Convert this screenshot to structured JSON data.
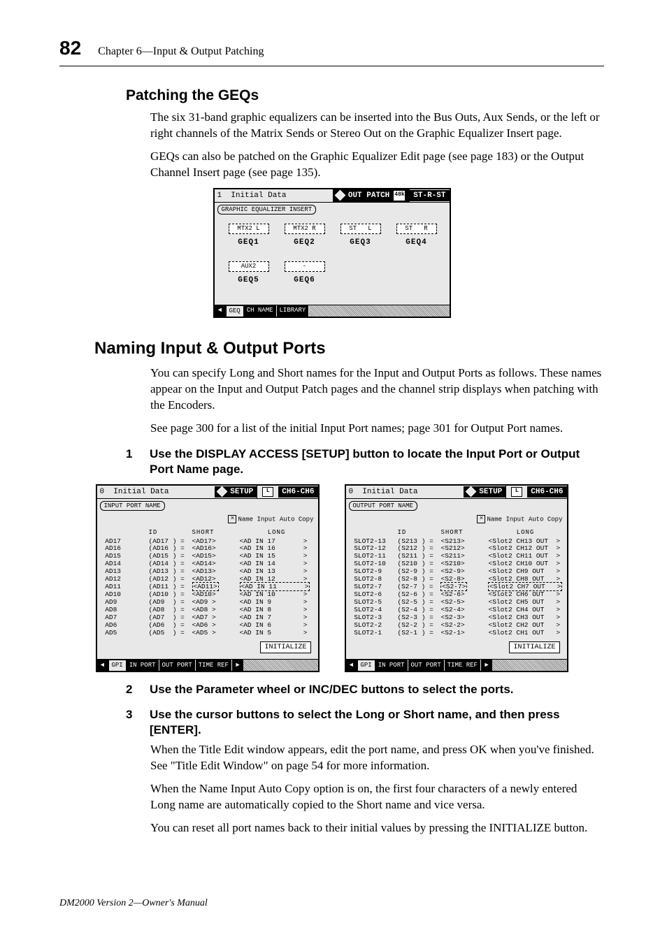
{
  "page": {
    "number": "82",
    "chapter_ref": "Chapter 6—Input & Output Patching",
    "footer": "DM2000 Version 2—Owner's Manual"
  },
  "sec_geq": {
    "title": "Patching the GEQs",
    "p1": "The six 31-band graphic equalizers can be inserted into the Bus Outs, Aux Sends, or the left or right channels of the Matrix Sends or Stereo Out on the Graphic Equalizer Insert page.",
    "p2": "GEQs can also be patched on the Graphic Equalizer Edit page (see page 183) or the Output Channel Insert page (see page 135)."
  },
  "geq_lcd": {
    "title_left": "1  Initial Data",
    "title_mid_a": "OUT PATCH",
    "title_mid_b_icon": "48k",
    "title_right": "ST-R-ST",
    "tab": "GRAPHIC EQUALIZER INSERT",
    "cells": [
      {
        "slot": "MTX2 L",
        "label": "GEQ1"
      },
      {
        "slot": "MTX2 R",
        "label": "GEQ2"
      },
      {
        "slot": "ST   L",
        "label": "GEQ3"
      },
      {
        "slot": "ST   R",
        "label": "GEQ4"
      },
      {
        "slot": "AUX2",
        "label": "GEQ5"
      },
      {
        "slot": "-",
        "label": "GEQ6"
      }
    ],
    "tabs": [
      "GEQ",
      "CH NAME",
      "LIBRARY"
    ]
  },
  "sec_naming": {
    "title": "Naming Input & Output Ports",
    "p1": "You can specify Long and Short names for the Input and Output Ports as follows. These names appear on the Input and Output Patch pages and the channel strip displays when patching with the Encoders.",
    "p2": "See page 300 for a list of the initial Input Port names; page 301 for Output Port names."
  },
  "steps": {
    "s1": "Use the DISPLAY ACCESS [SETUP] button to locate the Input Port or Output Port Name page.",
    "s2": "Use the Parameter wheel or INC/DEC buttons to select the ports.",
    "s3": "Use the cursor buttons to select the Long or Short name, and then press [ENTER]."
  },
  "after_steps": {
    "p1": "When the Title Edit window appears, edit the port name, and press OK when you've finished. See \"Title Edit Window\" on page 54 for more information.",
    "p2": "When the Name Input Auto Copy option is on, the first four characters of a newly entered Long name are automatically copied to the Short name and vice versa.",
    "p3": "You can reset all port names back to their initial values by pressing the INITIALIZE button."
  },
  "port_common": {
    "setup": "SETUP",
    "ch": "CH6-CH6",
    "check": "Name Input Auto Copy",
    "col_id": "ID",
    "col_short": "SHORT",
    "col_long": "LONG",
    "initialize": "INITIALIZE",
    "bottom_tabs": [
      "GPI",
      "IN PORT",
      "OUT PORT",
      "TIME REF"
    ]
  },
  "input_lcd": {
    "title_left": "0  Initial Data",
    "tab": "INPUT PORT NAME",
    "rows": [
      {
        "name": "AD17",
        "id": "(AD17 )",
        "short": "<AD17>",
        "long": "<AD IN 17       >"
      },
      {
        "name": "AD16",
        "id": "(AD16 )",
        "short": "<AD16>",
        "long": "<AD IN 16       >"
      },
      {
        "name": "AD15",
        "id": "(AD15 )",
        "short": "<AD15>",
        "long": "<AD IN 15       >"
      },
      {
        "name": "AD14",
        "id": "(AD14 )",
        "short": "<AD14>",
        "long": "<AD IN 14       >"
      },
      {
        "name": "AD13",
        "id": "(AD13 )",
        "short": "<AD13>",
        "long": "<AD IN 13       >"
      },
      {
        "name": "AD12",
        "id": "(AD12 )",
        "short": "<AD12>",
        "long": "<AD IN 12       >"
      },
      {
        "name": "AD11",
        "id": "(AD11 )",
        "short": "<AD11>",
        "long": "<AD IN 11       >",
        "hl": true
      },
      {
        "name": "AD10",
        "id": "(AD10 )",
        "short": "<AD10>",
        "long": "<AD IN 10       >"
      },
      {
        "name": "AD9",
        "id": "(AD9  )",
        "short": "<AD9 >",
        "long": "<AD IN 9        >"
      },
      {
        "name": "AD8",
        "id": "(AD8  )",
        "short": "<AD8 >",
        "long": "<AD IN 8        >"
      },
      {
        "name": "AD7",
        "id": "(AD7  )",
        "short": "<AD7 >",
        "long": "<AD IN 7        >"
      },
      {
        "name": "AD6",
        "id": "(AD6  )",
        "short": "<AD6 >",
        "long": "<AD IN 6        >"
      },
      {
        "name": "AD5",
        "id": "(AD5  )",
        "short": "<AD5 >",
        "long": "<AD IN 5        >"
      }
    ]
  },
  "output_lcd": {
    "title_left": "0  Initial Data",
    "tab": "OUTPUT PORT NAME",
    "rows": [
      {
        "name": "SLOT2-13",
        "id": "(S213 )",
        "short": "<S213>",
        "long": "<Slot2 CH13 OUT  >"
      },
      {
        "name": "SLOT2-12",
        "id": "(S212 )",
        "short": "<S212>",
        "long": "<Slot2 CH12 OUT  >"
      },
      {
        "name": "SLOT2-11",
        "id": "(S211 )",
        "short": "<S211>",
        "long": "<Slot2 CH11 OUT  >"
      },
      {
        "name": "SLOT2-10",
        "id": "(S210 )",
        "short": "<S210>",
        "long": "<Slot2 CH10 OUT  >"
      },
      {
        "name": "SLOT2-9",
        "id": "(S2-9 )",
        "short": "<S2-9>",
        "long": "<Slot2 CH9 OUT   >"
      },
      {
        "name": "SLOT2-8",
        "id": "(S2-8 )",
        "short": "<S2-8>",
        "long": "<Slot2 CH8 OUT   >"
      },
      {
        "name": "SLOT2-7",
        "id": "(S2-7 )",
        "short": "<S2-7>",
        "long": "<Slot2 CH7 OUT   >",
        "hl": true
      },
      {
        "name": "SLOT2-6",
        "id": "(S2-6 )",
        "short": "<S2-6>",
        "long": "<Slot2 CH6 OUT   >"
      },
      {
        "name": "SLOT2-5",
        "id": "(S2-5 )",
        "short": "<S2-5>",
        "long": "<Slot2 CH5 OUT   >"
      },
      {
        "name": "SLOT2-4",
        "id": "(S2-4 )",
        "short": "<S2-4>",
        "long": "<Slot2 CH4 OUT   >"
      },
      {
        "name": "SLOT2-3",
        "id": "(S2-3 )",
        "short": "<S2-3>",
        "long": "<Slot2 CH3 OUT   >"
      },
      {
        "name": "SLOT2-2",
        "id": "(S2-2 )",
        "short": "<S2-2>",
        "long": "<Slot2 CH2 OUT   >"
      },
      {
        "name": "SLOT2-1",
        "id": "(S2-1 )",
        "short": "<S2-1>",
        "long": "<Slot2 CH1 OUT   >"
      }
    ]
  }
}
